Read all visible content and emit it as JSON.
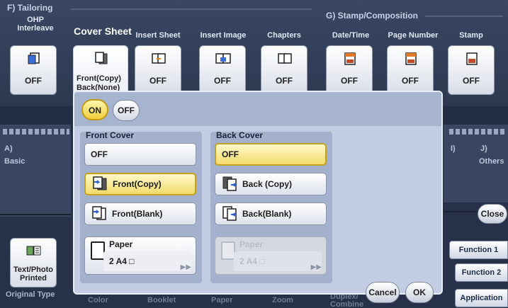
{
  "sections": {
    "tailoring": "F)  Tailoring",
    "stamp": "G)  Stamp/Composition"
  },
  "tabs": [
    {
      "label": "OHP\nInterleave",
      "value": "OFF"
    },
    {
      "label": "Cover Sheet",
      "value": "Front(Copy)\nBack(None)"
    },
    {
      "label": "Insert Sheet",
      "value": "OFF"
    },
    {
      "label": "Insert Image",
      "value": "OFF"
    },
    {
      "label": "Chapters",
      "value": "OFF"
    },
    {
      "label": "Date/Time",
      "value": "OFF"
    },
    {
      "label": "Page Number",
      "value": "OFF"
    },
    {
      "label": "Stamp",
      "value": "OFF"
    }
  ],
  "left_side": {
    "a_label": "A)",
    "basic_label": "Basic",
    "text_photo_label": "Text/Photo\nPrinted",
    "original_type_label": "Original Type"
  },
  "right_side": {
    "i_label": "I)",
    "j_label": "J)",
    "others_label": "Others",
    "close_label": "Close",
    "function1_label": "Function 1",
    "function2_label": "Function 2",
    "application_label": "Application"
  },
  "bottom_row": {
    "label1": "Color",
    "label2": "Booklet",
    "label3": "Paper",
    "label4": "Zoom",
    "label5": "Duplex/\nCombine"
  },
  "dialog": {
    "on_label": "ON",
    "off_label": "OFF",
    "front_cover": {
      "title": "Front Cover",
      "options": [
        "OFF",
        "Front(Copy)",
        "Front(Blank)"
      ],
      "selected": "Front(Copy)",
      "paper_label": "Paper",
      "paper_value": "2  A4"
    },
    "back_cover": {
      "title": "Back Cover",
      "options": [
        "OFF",
        "Back (Copy)",
        "Back(Blank)"
      ],
      "selected": "OFF",
      "paper_label": "Paper",
      "paper_value": "2  A4"
    },
    "cancel_label": "Cancel",
    "ok_label": "OK"
  },
  "colors": {
    "accent_yellow": "#f3db6c",
    "selected_border": "#c6a11d",
    "background": "#27324a",
    "dialog_bg": "#c2cde3"
  }
}
